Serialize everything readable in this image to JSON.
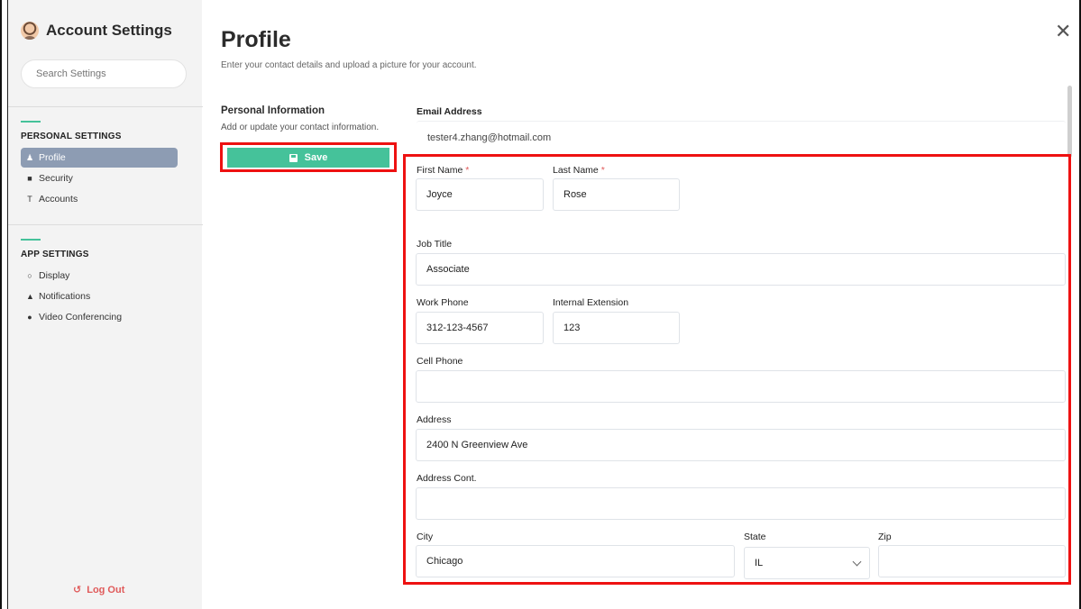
{
  "sidebar": {
    "title": "Account Settings",
    "search_placeholder": "Search Settings",
    "personal_section": "PERSONAL SETTINGS",
    "personal_items": [
      {
        "label": "Profile",
        "icon": "person-icon"
      },
      {
        "label": "Security",
        "icon": "lock-icon"
      },
      {
        "label": "Accounts",
        "icon": "accounts-icon"
      }
    ],
    "app_section": "APP SETTINGS",
    "app_items": [
      {
        "label": "Display",
        "icon": "gear-icon"
      },
      {
        "label": "Notifications",
        "icon": "bell-icon"
      },
      {
        "label": "Video Conferencing",
        "icon": "camera-icon"
      }
    ],
    "logout": "Log Out"
  },
  "main": {
    "title": "Profile",
    "subtitle": "Enter your contact details and upload a picture for your account.",
    "info_title": "Personal Information",
    "info_desc": "Add or update your contact information.",
    "save_label": "Save"
  },
  "form": {
    "email_label": "Email Address",
    "email_value": "tester4.zhang@hotmail.com",
    "first_name_label": "First Name",
    "first_name_value": "Joyce",
    "last_name_label": "Last Name",
    "last_name_value": "Rose",
    "required_mark": "*",
    "job_title_label": "Job Title",
    "job_title_value": "Associate",
    "work_phone_label": "Work Phone",
    "work_phone_value": "312-123-4567",
    "extension_label": "Internal Extension",
    "extension_value": "123",
    "cell_phone_label": "Cell Phone",
    "cell_phone_value": "",
    "address_label": "Address",
    "address_value": "2400 N Greenview Ave",
    "address2_label": "Address Cont.",
    "address2_value": "",
    "city_label": "City",
    "city_value": "Chicago",
    "state_label": "State",
    "state_value": "IL",
    "zip_label": "Zip",
    "zip_value": ""
  },
  "colors": {
    "accent": "#45c29a",
    "active_nav": "#8d9cb3",
    "highlight": "#ee1111",
    "logout": "#e05a5a"
  }
}
